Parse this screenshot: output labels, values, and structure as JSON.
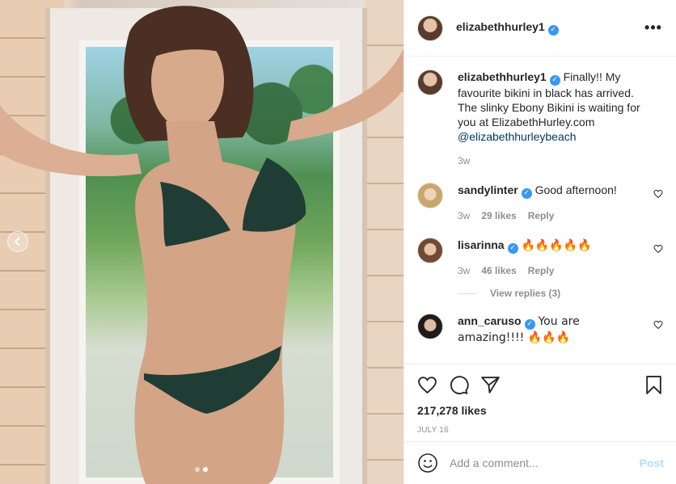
{
  "post": {
    "author": "elizabethhurley1",
    "verified": true
  },
  "caption": {
    "username": "elizabethhurley1",
    "text": "Finally!! My favourite bikini in black has arrived. The slinky Ebony Bikini is waiting for you at ElizabethHurley.com",
    "mention": "@elizabethhurleybeach",
    "time": "3w"
  },
  "comments": [
    {
      "username": "sandylinter",
      "text": "Good afternoon!",
      "time": "3w",
      "likes": "29 likes",
      "reply_label": "Reply"
    },
    {
      "username": "lisarinna",
      "text": "🔥🔥🔥🔥🔥",
      "time": "3w",
      "likes": "46 likes",
      "reply_label": "Reply"
    },
    {
      "username": "ann_caruso",
      "text": "You are amazing!!!! 🔥🔥🔥"
    }
  ],
  "view_replies": "View replies (3)",
  "actions": {
    "likes": "217,278 likes",
    "date": "JULY 16"
  },
  "add_comment": {
    "placeholder": "Add a comment...",
    "post_label": "Post"
  },
  "carousel": {
    "slide_count": 2,
    "active_slide": 2
  },
  "colors": {
    "verified": "#3897f0",
    "post_button": "#b2dffc",
    "mention": "#00376b"
  }
}
